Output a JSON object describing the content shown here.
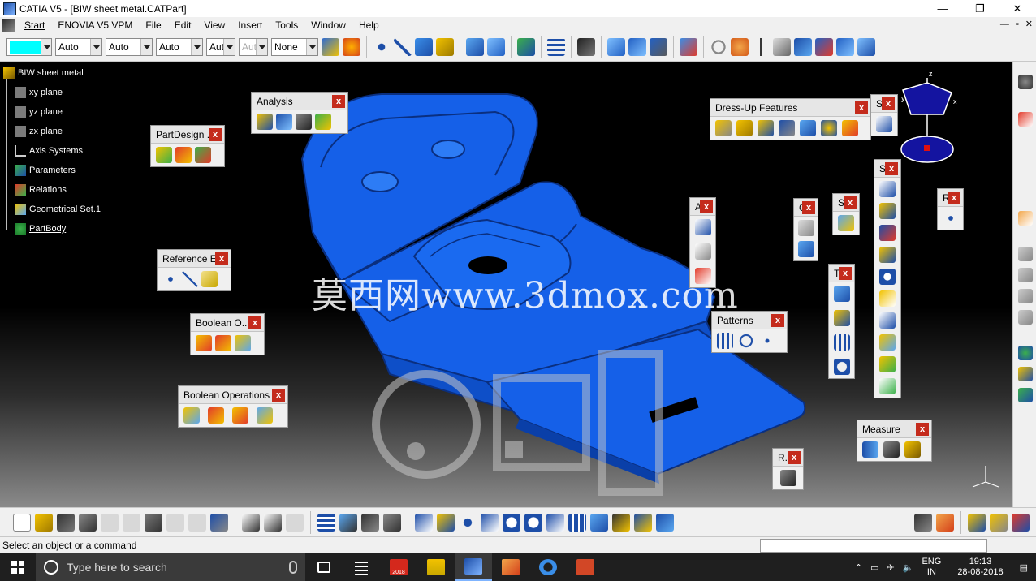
{
  "window": {
    "title": "CATIA V5 - [BIW sheet metal.CATPart]",
    "controls": [
      "—",
      "❐",
      "✕"
    ]
  },
  "menubar": {
    "items": [
      "Start",
      "ENOVIA V5 VPM",
      "File",
      "Edit",
      "View",
      "Insert",
      "Tools",
      "Window",
      "Help"
    ],
    "mdi_controls": [
      "—",
      "▫",
      "✕"
    ]
  },
  "toolbar": {
    "color_swatch": "#00ffff",
    "combo_values": [
      "Auto",
      "Auto",
      "Auto",
      "Aut",
      "Aut",
      "None"
    ]
  },
  "tree": {
    "root": "BIW sheet metal",
    "items": [
      "xy plane",
      "yz plane",
      "zx plane",
      "Axis Systems",
      "Parameters",
      "Relations",
      "Geometrical Set.1",
      "PartBody"
    ]
  },
  "panels": {
    "analysis": "Analysis",
    "partdesign": "PartDesign ...",
    "reference": "Reference E...",
    "boolean_short": "Boolean O...",
    "boolean": "Boolean Operations",
    "dressup": "Dress-Up Features",
    "patterns": "Patterns",
    "measure": "Measure",
    "a": "A",
    "s1": "S",
    "s2": "S",
    "s3": "S",
    "c": "C",
    "t": "T",
    "r1": "R",
    "r2": "R...",
    "close": "x"
  },
  "viewport": {
    "watermark": "莫西网www.3dmox.com",
    "compass_z": "z",
    "compass_y": "y",
    "compass_x": "x"
  },
  "status": {
    "message": "Select an object or a command"
  },
  "taskbar": {
    "search_placeholder": "Type here to search",
    "sw_badge": "2018",
    "language_top": "ENG",
    "language_bottom": "IN",
    "time": "19:13",
    "date": "28-08-2018"
  },
  "colors": {
    "part_blue": "#1560e8",
    "chrome": "#f0f0f0",
    "close_red": "#c42b1c"
  }
}
